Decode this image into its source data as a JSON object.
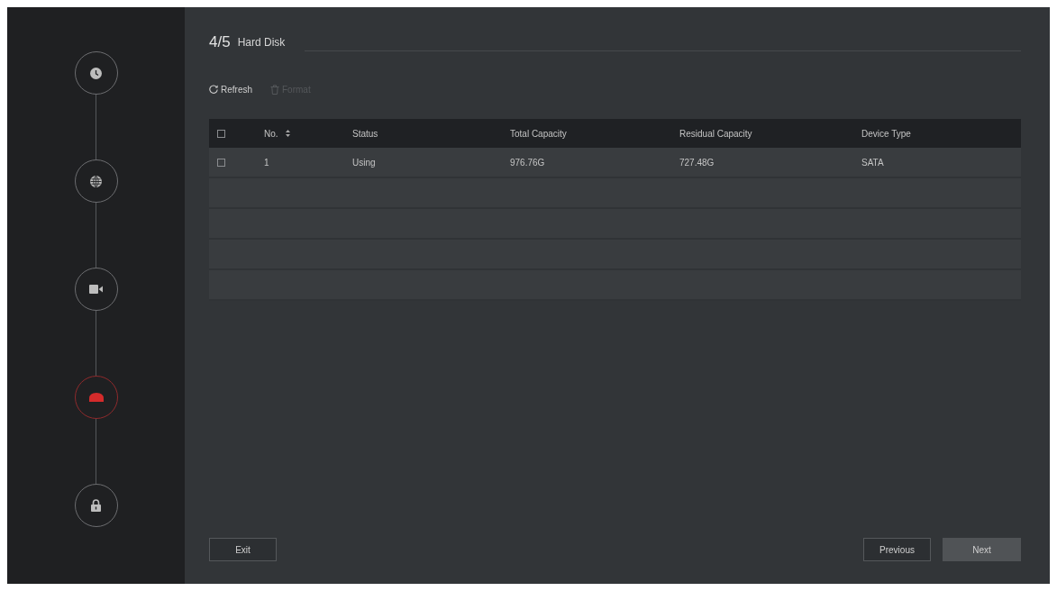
{
  "steps": [
    {
      "kind": "clock",
      "selected": false
    },
    {
      "kind": "network",
      "selected": false
    },
    {
      "kind": "camera",
      "selected": false
    },
    {
      "kind": "disk",
      "selected": true
    },
    {
      "kind": "lock",
      "selected": false
    }
  ],
  "page": {
    "step": "4/5",
    "title": "Hard Disk"
  },
  "toolbar": [
    {
      "kind": "refresh",
      "label": "Refresh",
      "disabled": false
    },
    {
      "kind": "format",
      "label": "Format",
      "disabled": true
    }
  ],
  "table": {
    "select_all": {
      "checked": false
    },
    "columns": [
      {
        "label": "No.",
        "sortable": true
      },
      {
        "label": "Status",
        "sortable": false
      },
      {
        "label": "Total Capacity",
        "sortable": false
      },
      {
        "label": "Residual Capacity",
        "sortable": false
      },
      {
        "label": "Device Type",
        "sortable": false
      }
    ],
    "rows": [
      {
        "checked": false,
        "cells": [
          "1",
          "Using",
          "976.76G",
          "727.48G",
          "SATA"
        ]
      }
    ]
  },
  "footer": {
    "left": [
      {
        "kind": "secondary",
        "label": "Exit"
      }
    ],
    "right": [
      {
        "kind": "secondary",
        "label": "Previous"
      },
      {
        "kind": "primary",
        "label": "Next"
      }
    ]
  }
}
